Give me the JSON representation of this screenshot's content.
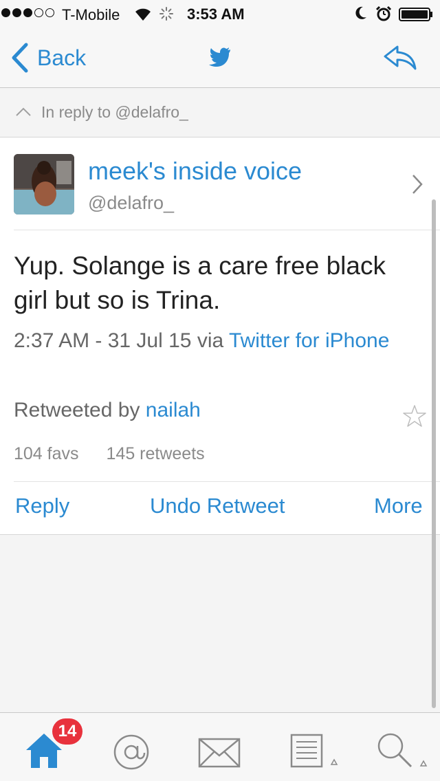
{
  "status_bar": {
    "carrier": "T-Mobile",
    "time": "3:53 AM",
    "signal_bars_filled": 3,
    "signal_bars_total": 5
  },
  "nav": {
    "back_label": "Back",
    "center_icon": "twitter-bird-icon",
    "right_icon": "reply-arrow-icon"
  },
  "reply_context": {
    "text": "In reply to @delafro_"
  },
  "tweet": {
    "display_name": "meek's inside voice",
    "handle": "@delafro_",
    "text": "Yup. Solange is a care free black girl but so is Trina.",
    "timestamp": "2:37 AM - 31 Jul 15 via ",
    "source": "Twitter for iPhone",
    "retweeted_prefix": "Retweeted by ",
    "retweeted_by": "nailah",
    "favs": "104 favs",
    "retweets": "145 retweets"
  },
  "actions": {
    "reply": "Reply",
    "undo_retweet": "Undo Retweet",
    "more": "More"
  },
  "tab_bar": {
    "home_badge": "14",
    "tabs": [
      "home-icon",
      "mentions-icon",
      "messages-icon",
      "lists-icon",
      "search-icon"
    ]
  },
  "colors": {
    "accent": "#2b8ad1",
    "badge": "#e8323d",
    "muted_text": "#8a8a8a"
  }
}
